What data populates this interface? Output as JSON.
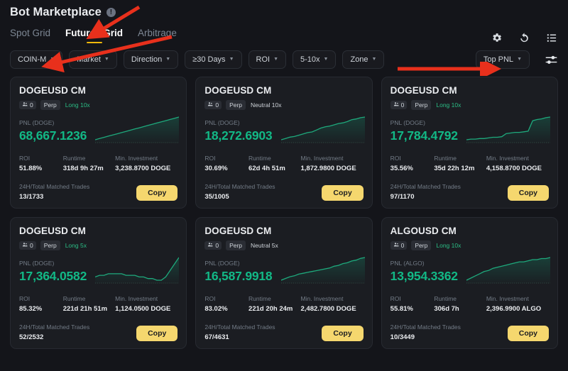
{
  "header": {
    "title": "Bot Marketplace",
    "info_icon": "info-icon"
  },
  "tabs": [
    {
      "label": "Spot Grid",
      "active": false
    },
    {
      "label": "Futures Grid",
      "active": true
    },
    {
      "label": "Arbitrage",
      "active": false
    }
  ],
  "header_icons": [
    {
      "name": "gear-icon"
    },
    {
      "name": "refresh-icon"
    },
    {
      "name": "list-icon"
    }
  ],
  "filters": [
    {
      "label": "COIN-M"
    },
    {
      "label": "Market"
    },
    {
      "label": "Direction"
    },
    {
      "label": "≥30 Days"
    },
    {
      "label": "ROI"
    },
    {
      "label": "5-10x"
    },
    {
      "label": "Zone"
    }
  ],
  "sort": {
    "label": "Top PNL"
  },
  "settings_icon": "sliders-icon",
  "labels": {
    "roi": "ROI",
    "runtime": "Runtime",
    "min_investment": "Min. Investment",
    "matched_trades": "24H/Total Matched Trades",
    "copy": "Copy"
  },
  "colors": {
    "accent": "#f0b90b",
    "profit_green": "#12b886",
    "copy_button": "#f5d76e",
    "card_bg": "#1b1d22",
    "page_bg": "#14151a"
  },
  "cards": [
    {
      "title": "DOGEUSD CM",
      "users": "0",
      "contract": "Perp",
      "direction": "Long 10x",
      "direction_type": "long",
      "pnl_label": "PNL (DOGE)",
      "pnl_value": "68,667.1236",
      "roi": "51.88%",
      "runtime": "318d 9h 27m",
      "min_investment": "3,238.8700 DOGE",
      "trades": "13/1733",
      "spark": [
        30,
        29,
        28,
        27,
        26,
        25,
        24,
        23,
        22,
        21,
        20,
        19,
        18,
        17,
        16,
        15,
        14,
        13,
        12,
        11
      ]
    },
    {
      "title": "DOGEUSD CM",
      "users": "0",
      "contract": "Perp",
      "direction": "Neutral 10x",
      "direction_type": "neutral",
      "pnl_label": "PNL (DOGE)",
      "pnl_value": "18,272.6903",
      "roi": "30.69%",
      "runtime": "62d 4h 51m",
      "min_investment": "1,872.9800 DOGE",
      "trades": "35/1005",
      "spark": [
        40,
        38,
        36,
        35,
        33,
        31,
        29,
        28,
        25,
        22,
        20,
        19,
        17,
        15,
        14,
        12,
        9,
        8,
        6,
        5
      ]
    },
    {
      "title": "DOGEUSD CM",
      "users": "0",
      "contract": "Perp",
      "direction": "Long 10x",
      "direction_type": "long",
      "pnl_label": "PNL (DOGE)",
      "pnl_value": "17,784.4792",
      "roi": "35.56%",
      "runtime": "35d 22h 12m",
      "min_investment": "4,158.8700 DOGE",
      "trades": "97/1170",
      "spark": [
        43,
        42,
        42,
        41,
        41,
        40,
        39,
        39,
        38,
        33,
        32,
        31,
        31,
        30,
        29,
        12,
        10,
        9,
        7,
        6
      ]
    },
    {
      "title": "DOGEUSD CM",
      "users": "0",
      "contract": "Perp",
      "direction": "Long 5x",
      "direction_type": "long",
      "pnl_label": "PNL (DOGE)",
      "pnl_value": "17,364.0582",
      "roi": "85.32%",
      "runtime": "221d 21h 51m",
      "min_investment": "1,124.0500 DOGE",
      "trades": "52/2532",
      "spark": [
        22,
        21,
        21,
        20,
        20,
        20,
        20,
        21,
        21,
        21,
        22,
        22,
        23,
        23,
        24,
        24,
        22,
        18,
        14,
        10
      ]
    },
    {
      "title": "DOGEUSD CM",
      "users": "0",
      "contract": "Perp",
      "direction": "Neutral 5x",
      "direction_type": "neutral",
      "pnl_label": "PNL (DOGE)",
      "pnl_value": "16,587.9918",
      "roi": "83.02%",
      "runtime": "221d 20h 24m",
      "min_investment": "2,482.7800 DOGE",
      "trades": "67/4631",
      "spark": [
        32,
        30,
        28,
        27,
        25,
        24,
        23,
        22,
        21,
        20,
        19,
        18,
        16,
        15,
        13,
        12,
        10,
        9,
        7,
        6
      ]
    },
    {
      "title": "ALGOUSD CM",
      "users": "0",
      "contract": "Perp",
      "direction": "Long 10x",
      "direction_type": "long",
      "pnl_label": "PNL (ALGO)",
      "pnl_value": "13,954.3362",
      "roi": "55.81%",
      "runtime": "306d 7h",
      "min_investment": "2,396.9900 ALGO",
      "trades": "10/3449",
      "spark": [
        28,
        26,
        24,
        22,
        20,
        19,
        17,
        16,
        15,
        14,
        13,
        12,
        11,
        11,
        10,
        9,
        9,
        8,
        8,
        7
      ]
    }
  ],
  "annotations": [
    {
      "name": "arrow-to-futures-grid"
    },
    {
      "name": "arrow-to-coin-m"
    },
    {
      "name": "arrow-to-top-pnl"
    }
  ]
}
